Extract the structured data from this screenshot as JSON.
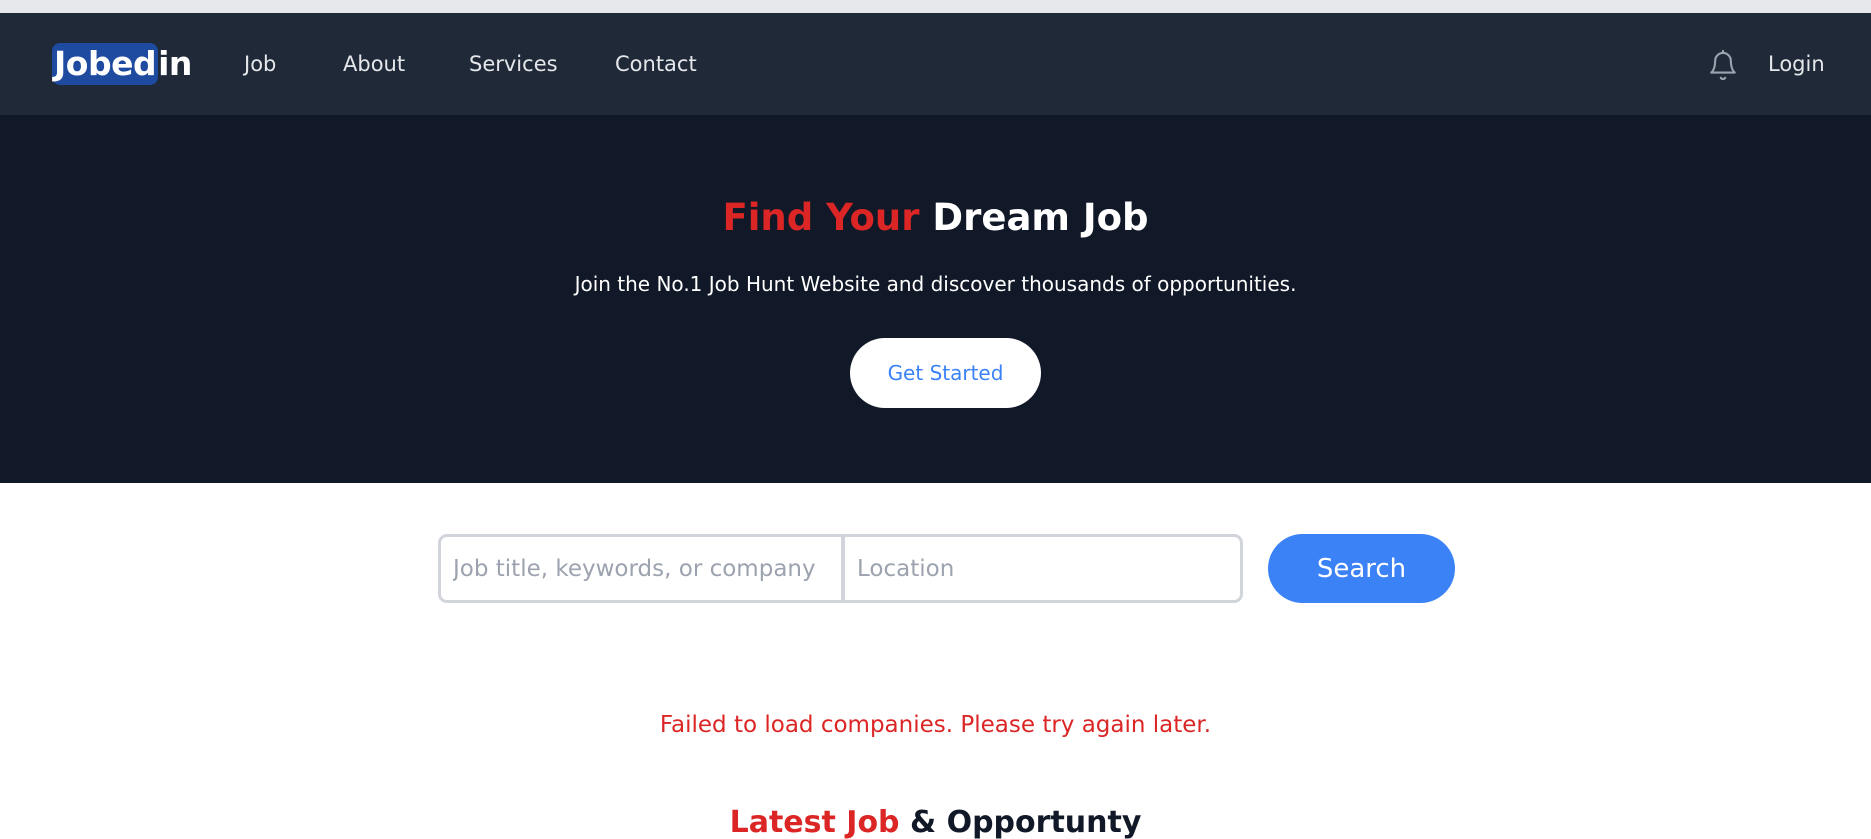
{
  "brand": {
    "logo_highlight": "Jobed",
    "logo_rest": "in"
  },
  "nav": {
    "links": [
      {
        "label": "Job"
      },
      {
        "label": "About"
      },
      {
        "label": "Services"
      },
      {
        "label": "Contact"
      }
    ],
    "notification_icon": "bell-icon",
    "login_label": "Login"
  },
  "hero": {
    "title_accent": "Find Your",
    "title_main": " Dream Job",
    "subtitle": "Join the No.1 Job Hunt Website and discover thousands of opportunities.",
    "cta_label": "Get Started"
  },
  "search": {
    "keyword_placeholder": "Job title, keywords, or company",
    "location_placeholder": "Location",
    "button_label": "Search"
  },
  "error_message": "Failed to load companies. Please try again later.",
  "latest_section": {
    "title_accent": "Latest Job",
    "title_main": " & Opportunty"
  },
  "colors": {
    "navbar_bg": "#1f2937",
    "hero_bg": "#111827",
    "accent_red": "#dc2626",
    "primary_blue": "#3b82f6",
    "logo_highlight": "#1e4ba0"
  }
}
